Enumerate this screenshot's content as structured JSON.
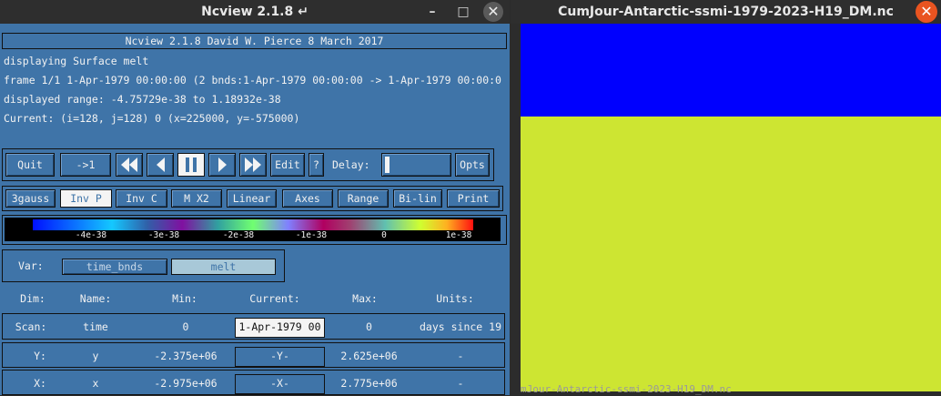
{
  "left_window": {
    "title": "Ncview 2.1.8 ↵",
    "btn_minimize": "–",
    "btn_maximize": "□",
    "btn_close": "✕",
    "info": {
      "banner": "Ncview 2.1.8 David W. Pierce  8 March 2017",
      "displaying": "displaying Surface melt",
      "frame": "frame 1/1 1-Apr-1979 00:00:00 (2 bnds:1-Apr-1979 00:00:00 -> 1-Apr-1979 00:00:0",
      "range": "displayed range: -4.75729e-38 to 1.18932e-38",
      "current": "Current: (i=128, j=128) 0 (x=225000, y=-575000)"
    },
    "controls": {
      "quit": "Quit",
      "to_one": "->1",
      "edit": "Edit",
      "help": "?",
      "delay_label": "Delay:",
      "opts": "Opts"
    },
    "options": [
      "3gauss",
      "Inv P",
      "Inv C",
      "M X2",
      "Linear",
      "Axes",
      "Range",
      "Bi-lin",
      "Print"
    ],
    "selected_option": "Inv P",
    "colorbar": {
      "labels": [
        "-4e-38",
        "-3e-38",
        "-2e-38",
        "-1e-38",
        "0",
        "1e-38"
      ]
    },
    "var": {
      "label": "Var:",
      "items": [
        "time_bnds",
        "melt"
      ],
      "selected": "melt"
    },
    "dims": {
      "headers": [
        "Dim:",
        "Name:",
        "Min:",
        "Current:",
        "Max:",
        "Units:"
      ],
      "rows": [
        {
          "dim": "Scan:",
          "name": "time",
          "min": "0",
          "current": "1-Apr-1979 00",
          "max": "0",
          "units": "days since 19"
        },
        {
          "dim": "Y:",
          "name": "y",
          "min": "-2.375e+06",
          "current": "-Y-",
          "max": "2.625e+06",
          "units": "-"
        },
        {
          "dim": "X:",
          "name": "x",
          "min": "-2.975e+06",
          "current": "-X-",
          "max": "2.775e+06",
          "units": "-"
        }
      ]
    }
  },
  "right_window": {
    "title": "CumJour-Antarctic-ssmi-1979-2023-H19_DM.nc",
    "btn_close": "✕",
    "colors": {
      "top": "#0000fe",
      "bottom": "#cde532"
    },
    "bottom_text": "mJour-Antarctic-ssmi-2023-H19_DM.nc"
  }
}
